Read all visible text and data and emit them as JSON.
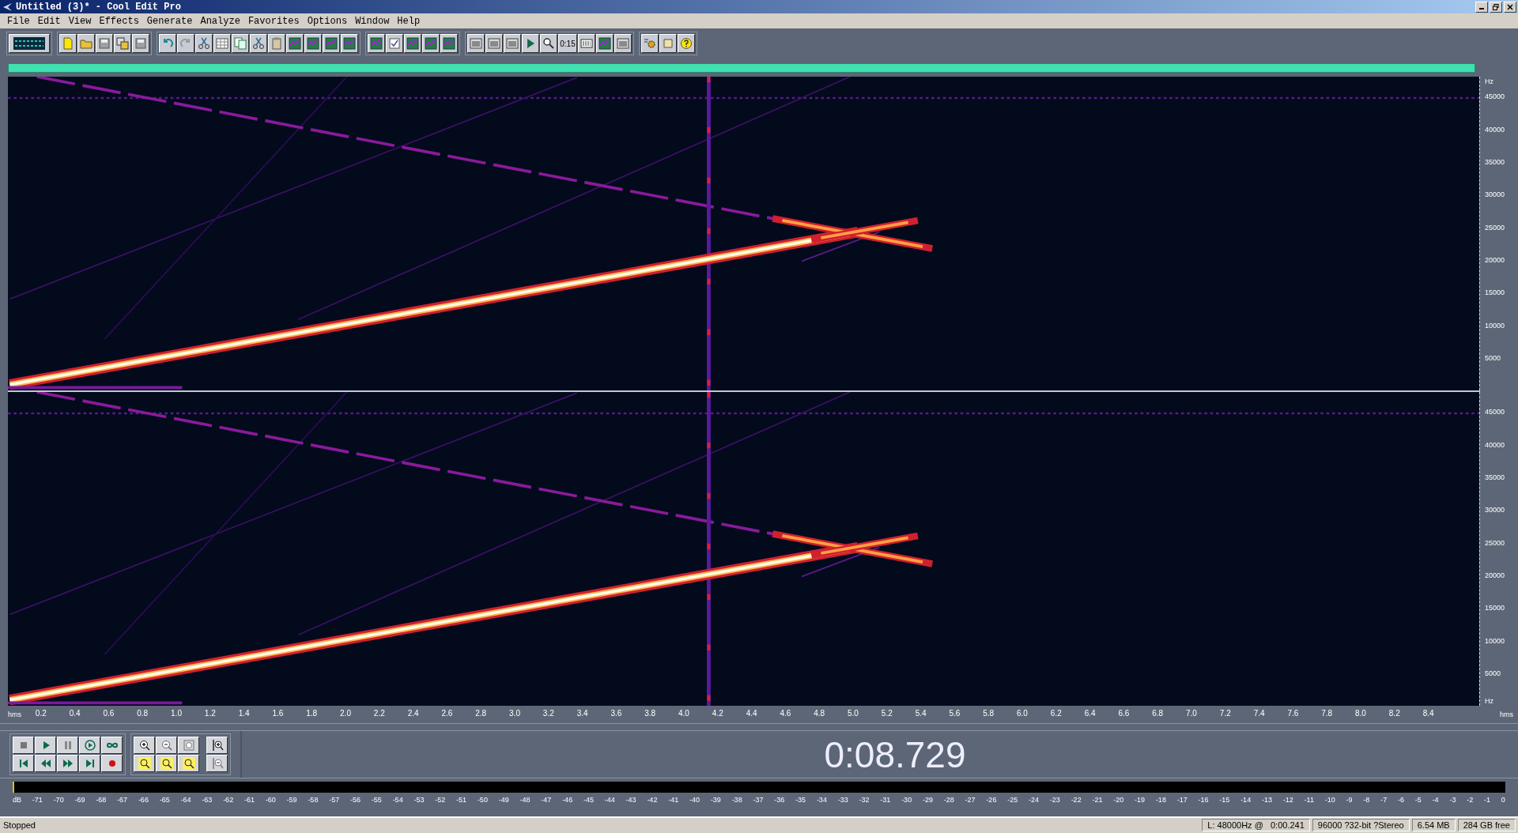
{
  "window": {
    "title": "Untitled (3)* - Cool Edit Pro"
  },
  "menu": [
    "File",
    "Edit",
    "View",
    "Effects",
    "Generate",
    "Analyze",
    "Favorites",
    "Options",
    "Window",
    "Help"
  ],
  "toolbar": {
    "time_button_label": "0:15"
  },
  "spectrogram": {
    "channels": [
      {
        "freq_labels": [
          "45000",
          "40000",
          "35000",
          "30000",
          "25000",
          "20000",
          "15000",
          "10000",
          "5000"
        ]
      },
      {
        "freq_labels": [
          "45000",
          "40000",
          "35000",
          "30000",
          "25000",
          "20000",
          "15000",
          "10000",
          "5000"
        ]
      }
    ],
    "top_unit": "Hz",
    "bottom_unit": "Hz",
    "time_unit_left": "hms",
    "time_unit_right": "hms",
    "time_labels": [
      "0.2",
      "0.4",
      "0.6",
      "0.8",
      "1.0",
      "1.2",
      "1.4",
      "1.6",
      "1.8",
      "2.0",
      "2.2",
      "2.4",
      "2.6",
      "2.8",
      "3.0",
      "3.2",
      "3.4",
      "3.6",
      "3.8",
      "4.0",
      "4.2",
      "4.4",
      "4.6",
      "4.8",
      "5.0",
      "5.2",
      "5.4",
      "5.6",
      "5.8",
      "6.0",
      "6.2",
      "6.4",
      "6.6",
      "6.8",
      "7.0",
      "7.2",
      "7.4",
      "7.6",
      "7.8",
      "8.0",
      "8.2",
      "8.4"
    ]
  },
  "time_display": "0:08.729",
  "level_meter": {
    "labels": [
      "dB",
      "-71",
      "-70",
      "-69",
      "-68",
      "-67",
      "-66",
      "-65",
      "-64",
      "-63",
      "-62",
      "-61",
      "-60",
      "-59",
      "-58",
      "-57",
      "-56",
      "-55",
      "-54",
      "-53",
      "-52",
      "-51",
      "-50",
      "-49",
      "-48",
      "-47",
      "-46",
      "-45",
      "-44",
      "-43",
      "-42",
      "-41",
      "-40",
      "-39",
      "-38",
      "-37",
      "-36",
      "-35",
      "-34",
      "-33",
      "-32",
      "-31",
      "-30",
      "-29",
      "-28",
      "-27",
      "-26",
      "-25",
      "-24",
      "-23",
      "-22",
      "-21",
      "-20",
      "-19",
      "-18",
      "-17",
      "-16",
      "-15",
      "-14",
      "-13",
      "-12",
      "-11",
      "-10",
      "-9",
      "-8",
      "-7",
      "-6",
      "-5",
      "-4",
      "-3",
      "-2",
      "-1",
      "0"
    ]
  },
  "status_bar": {
    "state": "Stopped",
    "fields": [
      "L: 48000Hz @   0:00.241",
      "96000 ?32-bit ?Stereo",
      "6.54 MB",
      "284 GB free"
    ]
  }
}
